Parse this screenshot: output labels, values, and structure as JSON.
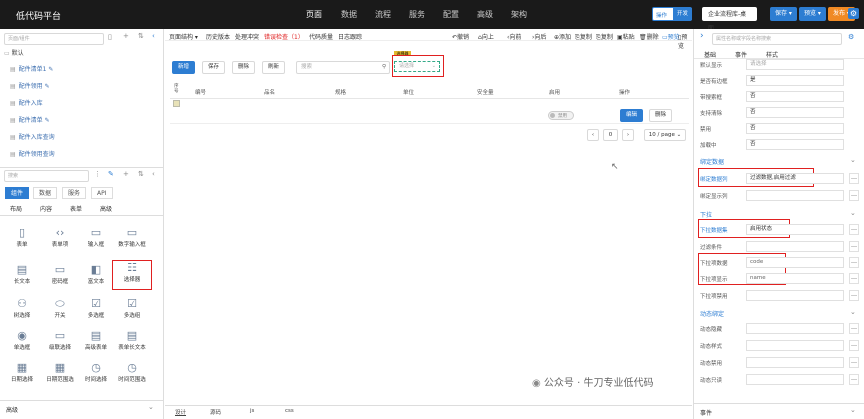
{
  "topbar": {
    "app_title": "低代码平台",
    "nav": [
      "页面",
      "数据",
      "流程",
      "服务",
      "配置",
      "高级",
      "架构"
    ],
    "toggle_a": "操作",
    "toggle_b": "开发",
    "env_label": "企业流程库-桌面",
    "save_label": "保存",
    "preview_label": "预览",
    "publish_label": "发布"
  },
  "left": {
    "search_placeholder": "页面/组件",
    "group_label": "默认",
    "pages": [
      "配件清单1",
      "配件领用",
      "配件入库",
      "配件清单",
      "配件入库查询",
      "配件领用查询"
    ],
    "comp_search": "搜索",
    "tabs": [
      "组件",
      "数据",
      "服务",
      "API"
    ],
    "subtabs": [
      "布局",
      "内容",
      "表单",
      "高级"
    ],
    "components": [
      [
        "表单",
        "表单项",
        "输入框",
        "数字输入框"
      ],
      [
        "长文本",
        "密码框",
        "富文本",
        "选择器"
      ],
      [
        "树选择",
        "开关",
        "多选框",
        "多选组"
      ],
      [
        "单选框",
        "级联选择",
        "高级表单",
        "表单长文本"
      ],
      [
        "日期选择",
        "日期范围选",
        "时间选择",
        "时间范围选"
      ]
    ],
    "footer": "高级"
  },
  "center": {
    "toolbar": [
      "页面结构 ▾",
      "历史版本",
      "处理冲突",
      "错误检查（1）",
      "代码质量",
      "日志跟踪"
    ],
    "toolbar_right": [
      "撤销",
      "向上",
      "向前",
      "向后",
      "添加",
      "复制",
      "复制",
      "粘贴",
      "删除",
      "预览",
      "预览"
    ],
    "buttons": [
      "新增",
      "保存",
      "删除",
      "刷新"
    ],
    "search_placeholder": "搜索",
    "select_placeholder": "请选择",
    "select_tag": "选择器",
    "columns": [
      "序号",
      "编号",
      "品名",
      "规格",
      "单位",
      "安全量",
      "启用",
      "操作"
    ],
    "row_switch": "禁用",
    "row_actions": [
      "编辑",
      "删除"
    ],
    "page_num": "0",
    "page_size": "10 / page",
    "bottom_tabs": [
      "设计",
      "源码",
      "js",
      "css"
    ]
  },
  "right": {
    "search_placeholder": "属性名称或字段名称搜索",
    "tabs": [
      "基础",
      "事件",
      "样式"
    ],
    "rows_top": [
      {
        "label": "默认显示",
        "value": "请选择"
      },
      {
        "label": "是否有边框",
        "value": "是"
      },
      {
        "label": "带搜索框",
        "value": "否"
      },
      {
        "label": "支持清除",
        "value": "否"
      },
      {
        "label": "禁用",
        "value": "否"
      },
      {
        "label": "加载中",
        "value": "否"
      }
    ],
    "section_bind": "绑定数据",
    "bind_rows": [
      {
        "label": "绑定数据列",
        "value": "过滤数据,启用过滤"
      },
      {
        "label": "绑定显示列",
        "value": ""
      }
    ],
    "section_dropdown": "下拉",
    "dropdown_rows": [
      {
        "label": "下拉数据集",
        "value": "启用状态"
      },
      {
        "label": "过滤条件",
        "value": ""
      },
      {
        "label": "下拉项数据",
        "value": "code"
      },
      {
        "label": "下拉项显示",
        "value": "name"
      },
      {
        "label": "下拉项禁用",
        "value": ""
      }
    ],
    "section_dynamic": "动态绑定",
    "dynamic_rows": [
      {
        "label": "动态隐藏",
        "value": ""
      },
      {
        "label": "动态样式",
        "value": ""
      },
      {
        "label": "动态禁用",
        "value": ""
      },
      {
        "label": "动态只读",
        "value": ""
      }
    ],
    "footer": "事件"
  },
  "watermark": "公众号 · 牛刀专业低代码",
  "colors": {
    "primary": "#2d7dd2",
    "highlight": "#e02020",
    "topbar": "#1a1a1a",
    "orange": "#f08a24"
  }
}
